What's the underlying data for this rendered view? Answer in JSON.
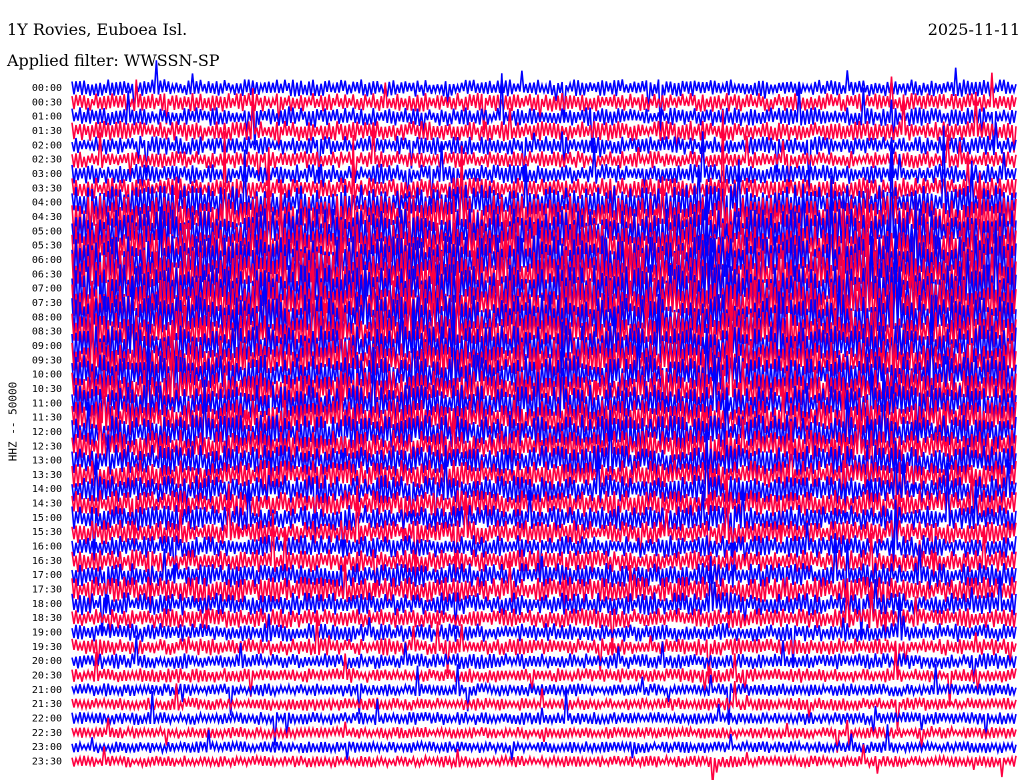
{
  "header": {
    "station": "1Y Rovies, Euboea Isl.",
    "filter": "Applied filter: WWSSN-SP",
    "date": "2025-11-11"
  },
  "chart_data": {
    "type": "line",
    "title": "1Y Rovies, Euboea Isl.",
    "subtitle": "Applied filter: WWSSN-SP",
    "ylabel": "HHZ -- 50000",
    "series_colors": [
      "#0000ff",
      "#ff0040"
    ],
    "row_labels": [
      "00:00",
      "00:30",
      "01:00",
      "01:30",
      "02:00",
      "02:30",
      "03:00",
      "03:30",
      "04:00",
      "04:30",
      "05:00",
      "05:30",
      "06:00",
      "06:30",
      "07:00",
      "07:30",
      "08:00",
      "08:30",
      "09:00",
      "09:30",
      "10:00",
      "10:30",
      "11:00",
      "11:30",
      "12:00",
      "12:30",
      "13:00",
      "13:30",
      "14:00",
      "14:30",
      "15:00",
      "15:30",
      "16:00",
      "16:30",
      "17:00",
      "17:30",
      "18:00",
      "18:30",
      "19:00",
      "19:30",
      "20:00",
      "20:30",
      "21:00",
      "21:30",
      "22:00",
      "22:30",
      "23:00",
      "23:30"
    ],
    "relative_amplitude": [
      1.2,
      1.3,
      1.3,
      1.4,
      1.3,
      1.2,
      1.4,
      1.5,
      2.5,
      3.0,
      3.2,
      3.3,
      3.4,
      3.4,
      3.4,
      3.3,
      3.2,
      3.0,
      2.9,
      2.8,
      2.8,
      2.7,
      2.6,
      2.5,
      2.4,
      2.3,
      2.2,
      2.1,
      2.0,
      1.9,
      1.8,
      1.7,
      1.6,
      1.6,
      1.7,
      1.8,
      1.6,
      1.4,
      1.3,
      1.2,
      1.1,
      1.0,
      0.9,
      0.9,
      0.9,
      0.8,
      0.8,
      0.8
    ]
  }
}
